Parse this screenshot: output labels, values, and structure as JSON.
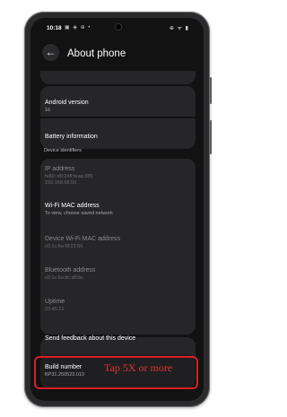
{
  "status_bar": {
    "time": "10:18",
    "left_icons": "▣ ◈ ⊕ •",
    "right_icons": "⊕ ᯤ ▮"
  },
  "header": {
    "title": "About phone"
  },
  "rows": {
    "android_version": {
      "title": "Android version",
      "value": "16"
    },
    "battery": {
      "title": "Battery information"
    },
    "ip": {
      "title": "IP address",
      "value1": "fe80::d0:24ff:feaa:385",
      "value2": "192.168.68.50"
    },
    "wifi_mac": {
      "title": "Wi-Fi MAC address",
      "value": "To view, choose saved network"
    },
    "device_mac": {
      "title": "Device Wi-Fi MAC address",
      "value": "c0:1c:6a:9f:23:69"
    },
    "bluetooth": {
      "title": "Bluetooth address",
      "value": "c0:1c:6a:8c:d9:bc"
    },
    "uptime": {
      "title": "Uptime",
      "value": "23:45:21"
    },
    "feedback": {
      "title": "Send feedback about this device"
    },
    "build": {
      "title": "Build number",
      "value": "BP31.250523.010"
    }
  },
  "sections": {
    "device_identifiers": "Device identifiers"
  },
  "annotation": {
    "text": "Tap 5X or more",
    "color": "#e0342f",
    "box_color": "#d81f26"
  },
  "icons": {
    "back": "arrow-back-icon"
  }
}
